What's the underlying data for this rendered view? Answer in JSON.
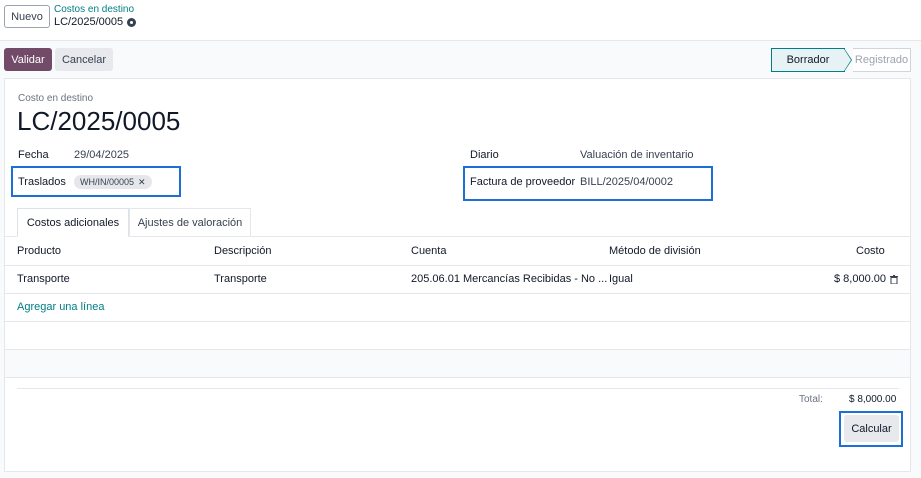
{
  "top": {
    "new_button": "Nuevo",
    "breadcrumb_parent": "Costos en destino",
    "breadcrumb_current": "LC/2025/0005"
  },
  "actions": {
    "validate": "Validar",
    "cancel": "Cancelar"
  },
  "status": {
    "draft": "Borrador",
    "posted": "Registrado",
    "active": "Borrador"
  },
  "form": {
    "subtitle": "Costo en destino",
    "reference": "LC/2025/0005",
    "date_label": "Fecha",
    "date_value": "29/04/2025",
    "transfers_label": "Traslados",
    "transfer_tag": "WH/IN/00005",
    "journal_label": "Diario",
    "journal_value": "Valuación de inventario",
    "vendor_bill_label": "Factura de proveedor",
    "vendor_bill_value": "BILL/2025/04/0002"
  },
  "tabs": [
    {
      "label": "Costos adicionales",
      "active": true
    },
    {
      "label": "Ajustes de valoración",
      "active": false
    }
  ],
  "table": {
    "headers": [
      "Producto",
      "Descripción",
      "Cuenta",
      "Método de división",
      "Costo"
    ],
    "rows": [
      [
        "Transporte",
        "Transporte",
        "205.06.01 Mercancías Recibidas - No ...",
        "Igual",
        "$ 8,000.00"
      ]
    ],
    "add_line": "Agregar una línea"
  },
  "footer": {
    "total_label": "Total:",
    "total_value": "$ 8,000.00",
    "compute_button": "Calcular"
  },
  "colors": {
    "primary": "#714b67",
    "link": "#017e84",
    "highlight": "#1d6fd8"
  }
}
